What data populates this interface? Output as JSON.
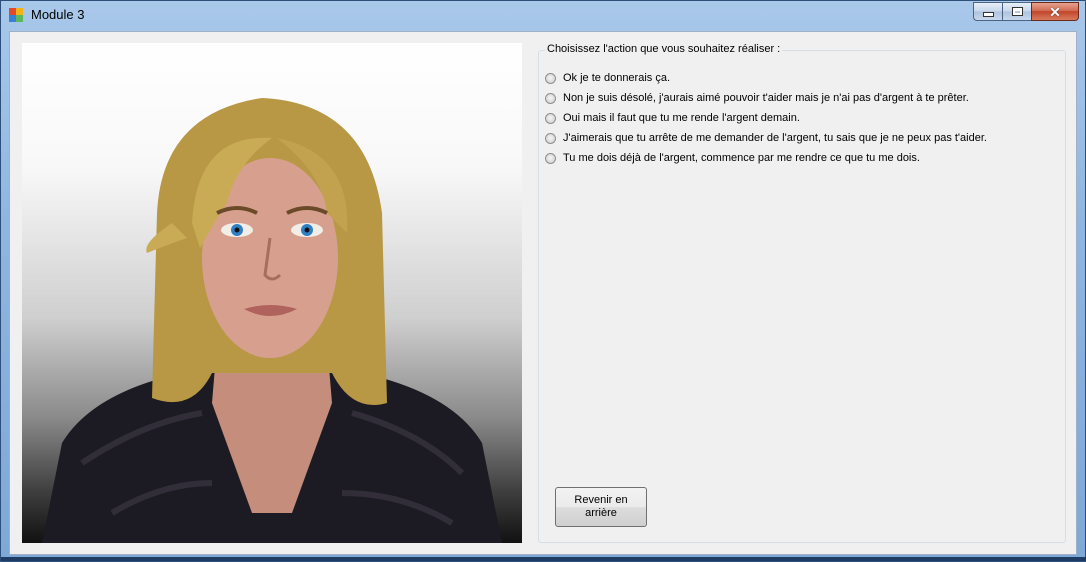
{
  "window": {
    "title": "Module 3",
    "controls": {
      "minimize": "minimize",
      "maximize": "maximize",
      "close": "close"
    }
  },
  "avatar": {
    "description_icon": "character-face-image"
  },
  "choices": {
    "legend": "Choisissez l'action que vous souhaitez réaliser :",
    "options": [
      "Ok je te donnerais ça.",
      "Non je suis désolé, j'aurais aimé pouvoir t'aider mais je n'ai pas d'argent à te prêter.",
      "Oui mais il faut que tu me rende l'argent demain.",
      "J'aimerais que tu arrête de me demander de l'argent, tu sais que je ne peux pas t'aider.",
      "Tu me dois déjà de l'argent, commence par me rendre ce que tu me dois."
    ]
  },
  "back_button": {
    "label": "Revenir en arrière"
  },
  "colors": {
    "titlebar": "#a9c8ea",
    "client_bg": "#f0f0f0",
    "close_button": "#c2452a"
  }
}
